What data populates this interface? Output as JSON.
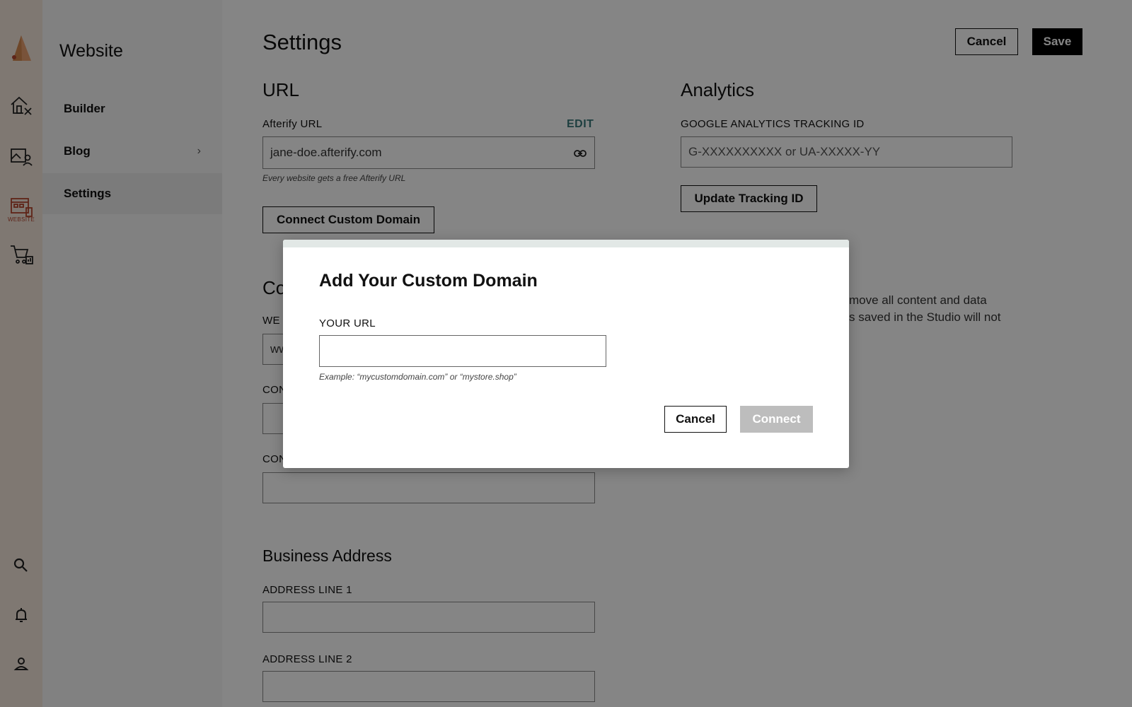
{
  "rail": {
    "items": [
      {
        "icon": "home-tools-icon"
      },
      {
        "icon": "gallery-user-icon"
      },
      {
        "icon": "website-icon",
        "label": "WEBSITE",
        "active": true
      },
      {
        "icon": "cart-stats-icon"
      },
      {
        "icon": "search-icon"
      },
      {
        "icon": "bell-icon"
      },
      {
        "icon": "user-icon"
      }
    ]
  },
  "sidebar": {
    "title": "Website",
    "items": [
      {
        "label": "Builder"
      },
      {
        "label": "Blog",
        "chevron": "›"
      },
      {
        "label": "Settings",
        "active": true
      }
    ]
  },
  "header": {
    "title": "Settings",
    "cancel_label": "Cancel",
    "save_label": "Save"
  },
  "url_section": {
    "heading": "URL",
    "field_label": "Afterify URL",
    "edit_label": "EDIT",
    "value": "jane-doe.afterify.com",
    "hint": "Every website gets a free Afterify URL",
    "connect_button": "Connect Custom Domain"
  },
  "analytics_section": {
    "heading": "Analytics",
    "field_label": "GOOGLE ANALYTICS TRACKING ID",
    "placeholder": "G-XXXXXXXXXX or UA-XXXXX-YY",
    "update_button": "Update Tracking ID"
  },
  "contact_section": {
    "heading_partial": "Co",
    "label1_partial": "WE",
    "value1_partial": "ww",
    "label2_partial": "CON",
    "label3_partial": "CON"
  },
  "right_text": {
    "line1": "move all content and data",
    "line2": "s saved in the Studio will not"
  },
  "business_address": {
    "heading": "Business Address",
    "line1_label": "ADDRESS LINE 1",
    "line2_label": "ADDRESS LINE 2"
  },
  "modal": {
    "title": "Add Your Custom Domain",
    "field_label": "YOUR URL",
    "value": "",
    "hint": "Example: “mycustomdomain.com” or “mystore.shop”",
    "cancel_label": "Cancel",
    "connect_label": "Connect",
    "connect_disabled": true
  },
  "colors": {
    "rail_bg": "#f3e6db",
    "accent": "#b5452e",
    "edit_link": "#3a7a7c",
    "overlay": "rgba(0,0,0,0.48)"
  }
}
